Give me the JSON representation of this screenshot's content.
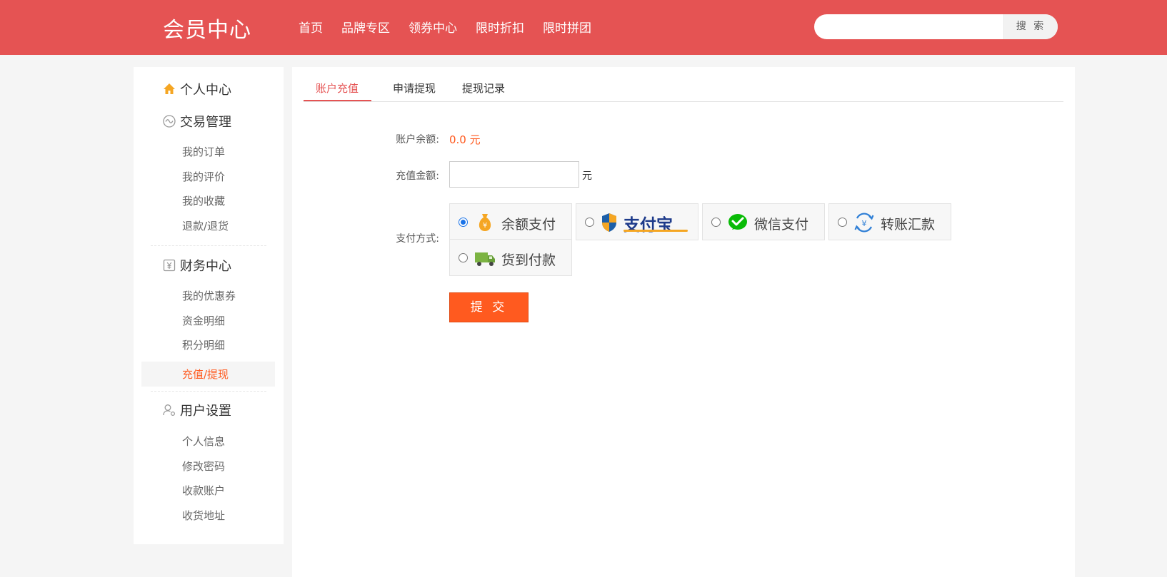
{
  "header": {
    "logo": "会员中心",
    "nav": [
      "首页",
      "品牌专区",
      "领券中心",
      "限时折扣",
      "限时拼团"
    ],
    "search_value": "",
    "search_button": "搜 索"
  },
  "sidebar": {
    "home": "个人中心",
    "trade": {
      "title": "交易管理",
      "links": [
        "我的订单",
        "我的评价",
        "我的收藏",
        "退款/退货"
      ]
    },
    "finance": {
      "title": "财务中心",
      "links": [
        "我的优惠券",
        "资金明细",
        "积分明细",
        "充值/提现"
      ],
      "active_index": 3
    },
    "settings": {
      "title": "用户设置",
      "links": [
        "个人信息",
        "修改密码",
        "收款账户",
        "收货地址"
      ]
    }
  },
  "main": {
    "tabs": [
      "账户充值",
      "申请提现",
      "提现记录"
    ],
    "active_tab": 0,
    "balance_label": "账户余额:",
    "balance_value": "0.0 元",
    "amount_label": "充值金额:",
    "amount_value": "",
    "amount_unit": "元",
    "pay_label": "支付方式:",
    "pay_options": [
      {
        "text": "余额支付",
        "icon": "money-bag-icon",
        "checked": true
      },
      {
        "text": "支付宝",
        "icon": "alipay-logo",
        "checked": false
      },
      {
        "text": "微信支付",
        "icon": "wechat-pay-icon",
        "checked": false
      },
      {
        "text": "转账汇款",
        "icon": "bank-transfer-icon",
        "checked": false
      },
      {
        "text": "货到付款",
        "icon": "delivery-truck-icon",
        "checked": false
      }
    ],
    "submit": "提 交"
  },
  "colors": {
    "header_bg": "#e55353",
    "accent_orange": "#ff5a1f",
    "tab_active": "#e55353",
    "radio_checked": "#1a73e8"
  }
}
